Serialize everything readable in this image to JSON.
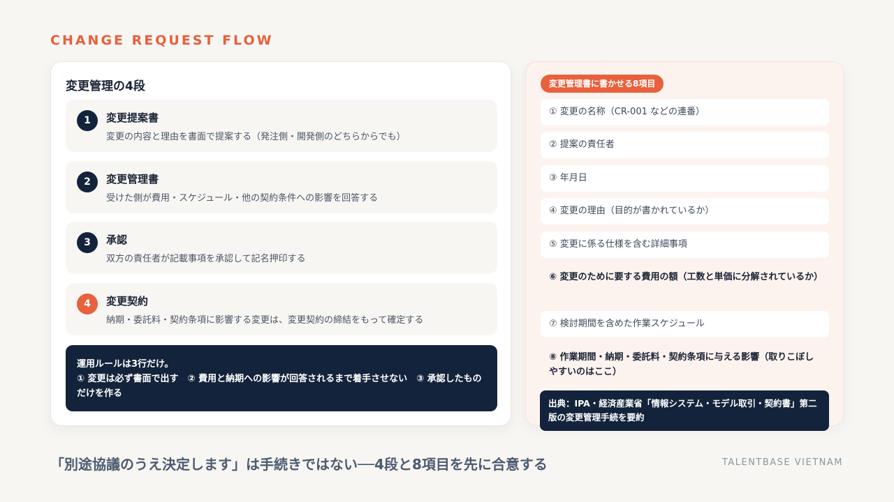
{
  "kicker": "CHANGE REQUEST FLOW",
  "left": {
    "title": "変更管理の4段",
    "steps": [
      {
        "num": "1",
        "title": "変更提案書",
        "desc": "変更の内容と理由を書面で提案する（発注側・開発側のどちらからでも）"
      },
      {
        "num": "2",
        "title": "変更管理書",
        "desc": "受けた側が費用・スケジュール・他の契約条件への影響を回答する"
      },
      {
        "num": "3",
        "title": "承認",
        "desc": "双方の責任者が記載事項を承認して記名押印する"
      },
      {
        "num": "4",
        "title": "変更契約",
        "desc": "納期・委託料・契約条項に影響する変更は、変更契約の締結をもって確定する"
      }
    ],
    "rules_line1": "運用ルールは3行だけ。",
    "rules_line2": "① 変更は必ず書面で出す　② 費用と納期への影響が回答されるまで着手させない　③ 承認したものだけを作る"
  },
  "right": {
    "pill": "変更管理書に書かせる8項目",
    "items": [
      "① 変更の名称（CR-001 などの連番）",
      "② 提案の責任者",
      "③ 年月日",
      "④ 変更の理由（目的が書かれているか）",
      "⑤ 変更に係る仕様を含む詳細事項",
      "⑥ 変更のために要する費用の額（工数と単価に分解されているか）",
      "⑦ 検討期間を含めた作業スケジュール",
      "⑧ 作業期間・納期・委託料・契約条項に与える影響（取りこぼしやすいのはここ）"
    ],
    "source": "出典：IPA・経済産業省「情報システム・モデル取引・契約書」第二版の変更管理手続を要約"
  },
  "headline": "「別途協議のうえ決定します」は手続きではない──4段と8項目を先に合意する",
  "brand": "TALENTBASE VIETNAM",
  "colors": {
    "accent": "#e8603c",
    "navy": "#13233b",
    "background": "#f8f6f3"
  }
}
